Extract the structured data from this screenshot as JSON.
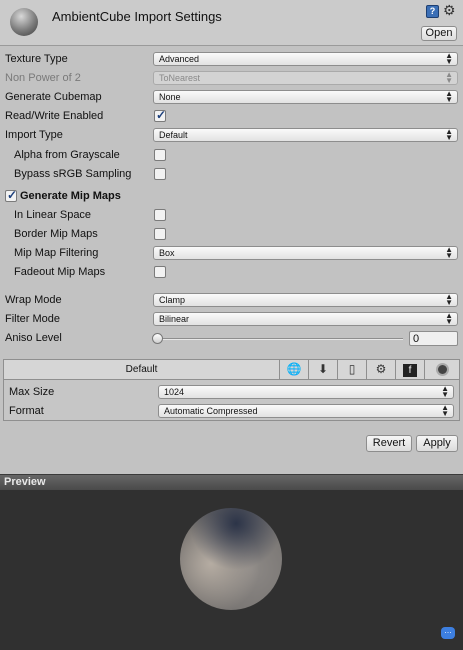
{
  "header": {
    "title": "AmbientCube Import Settings",
    "help_icon": "?",
    "gear_icon": "gear-icon",
    "open_label": "Open"
  },
  "settings": {
    "texture_type": {
      "label": "Texture Type",
      "value": "Advanced"
    },
    "non_power_of_2": {
      "label": "Non Power of 2",
      "value": "ToNearest"
    },
    "generate_cubemap": {
      "label": "Generate Cubemap",
      "value": "None"
    },
    "read_write": {
      "label": "Read/Write Enabled",
      "checked": true
    },
    "import_type": {
      "label": "Import Type",
      "value": "Default"
    },
    "alpha_from_grayscale": {
      "label": "Alpha from Grayscale",
      "checked": false
    },
    "bypass_srgb": {
      "label": "Bypass sRGB Sampling",
      "checked": false
    },
    "generate_mip_maps": {
      "label": "Generate Mip Maps",
      "checked": true
    },
    "in_linear_space": {
      "label": "In Linear Space",
      "checked": false
    },
    "border_mip_maps": {
      "label": "Border Mip Maps",
      "checked": false
    },
    "mip_map_filtering": {
      "label": "Mip Map Filtering",
      "value": "Box"
    },
    "fadeout_mip_maps": {
      "label": "Fadeout Mip Maps",
      "checked": false
    },
    "wrap_mode": {
      "label": "Wrap Mode",
      "value": "Clamp"
    },
    "filter_mode": {
      "label": "Filter Mode",
      "value": "Bilinear"
    },
    "aniso_level": {
      "label": "Aniso Level",
      "value": "0"
    }
  },
  "platform": {
    "default_tab": "Default",
    "tab_icons": [
      "globe-icon",
      "download-icon",
      "phone-icon",
      "android-icon",
      "flash-icon",
      "circle-icon"
    ],
    "max_size": {
      "label": "Max Size",
      "value": "1024"
    },
    "format": {
      "label": "Format",
      "value": "Automatic Compressed"
    }
  },
  "actions": {
    "revert": "Revert",
    "apply": "Apply"
  },
  "preview": {
    "title": "Preview"
  }
}
